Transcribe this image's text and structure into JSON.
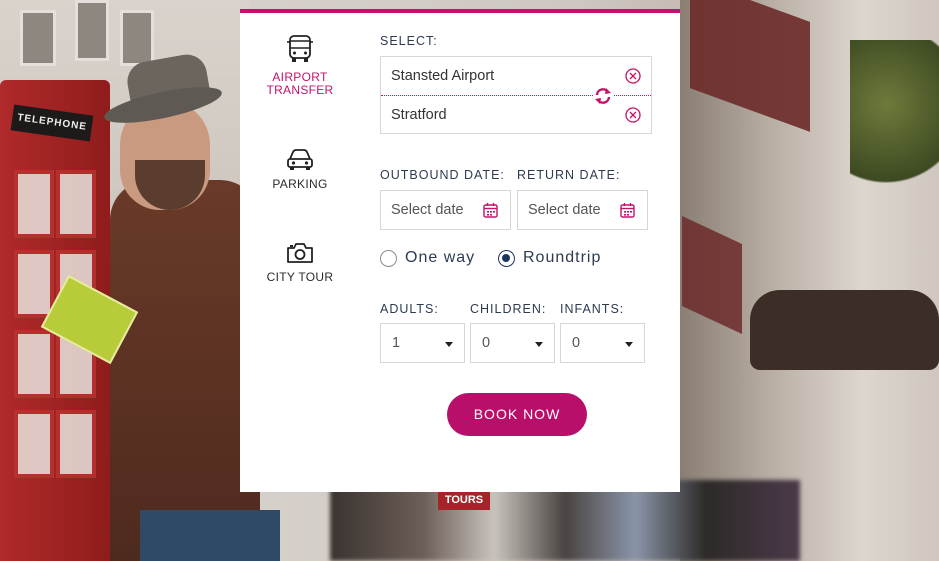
{
  "sidebar": {
    "items": [
      {
        "label": "AIRPORT TRANSFER",
        "icon": "bus-icon",
        "active": true
      },
      {
        "label": "PARKING",
        "icon": "car-icon",
        "active": false
      },
      {
        "label": "CITY TOUR",
        "icon": "camera-icon",
        "active": false
      }
    ]
  },
  "form": {
    "select_label": "SELECT:",
    "from_value": "Stansted Airport",
    "to_value": "Stratford",
    "outbound_label": "OUTBOUND DATE:",
    "return_label": "RETURN DATE:",
    "outbound_placeholder": "Select date",
    "return_placeholder": "Select date",
    "trip_options": [
      {
        "label": "One way",
        "selected": false
      },
      {
        "label": "Roundtrip",
        "selected": true
      }
    ],
    "adults_label": "ADULTS:",
    "children_label": "CHILDREN:",
    "infants_label": "INFANTS:",
    "adults_value": "1",
    "children_value": "0",
    "infants_value": "0",
    "book_button": "BOOK NOW"
  },
  "background_signs": {
    "phonebox_sign": "TELEPHONE",
    "tours_sign": "TOURS"
  },
  "colors": {
    "accent": "#c2126b",
    "button": "#b8106a",
    "text": "#2d3b52",
    "radio_selected": "#1d3461"
  }
}
